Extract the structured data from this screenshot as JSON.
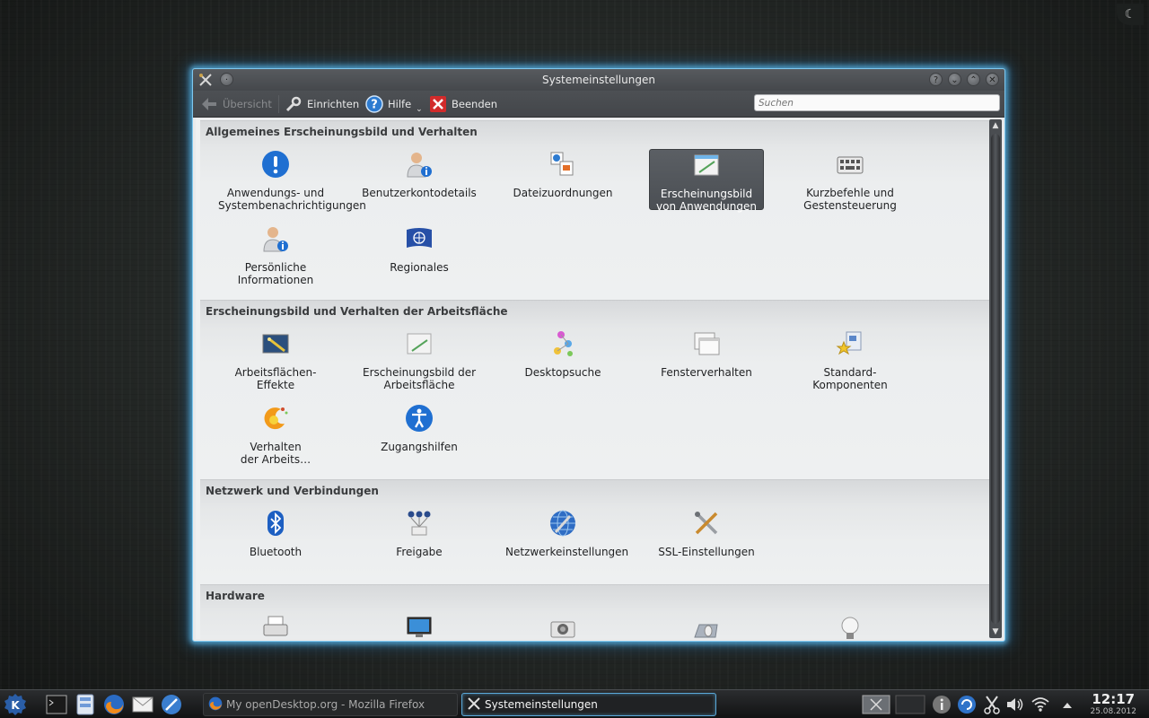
{
  "window": {
    "title": "Systemeinstellungen"
  },
  "toolbar": {
    "overview": "Übersicht",
    "configure": "Einrichten",
    "help": "Hilfe",
    "quit": "Beenden",
    "search_placeholder": "Suchen"
  },
  "sections": [
    {
      "title": "Allgemeines Erscheinungsbild und Verhalten",
      "items": [
        {
          "label": "Anwendungs- und Systembenachrichtigungen",
          "icon": "notification-icon"
        },
        {
          "label": "Benutzerkontodetails",
          "icon": "user-account-icon"
        },
        {
          "label": "Dateizuordnungen",
          "icon": "file-associations-icon"
        },
        {
          "label": "Erscheinungsbild von Anwendungen",
          "icon": "app-appearance-icon",
          "selected": true
        },
        {
          "label": "Kurzbefehle und Gestensteuerung",
          "icon": "keyboard-icon"
        },
        {
          "label": "Persönliche Informationen",
          "icon": "personal-info-icon"
        },
        {
          "label": "Regionales",
          "icon": "flag-icon"
        }
      ]
    },
    {
      "title": "Erscheinungsbild und Verhalten der Arbeitsfläche",
      "items": [
        {
          "label": "Arbeitsflächen-Effekte",
          "icon": "desktop-effects-icon"
        },
        {
          "label": "Erscheinungsbild der Arbeitsfläche",
          "icon": "workspace-appearance-icon"
        },
        {
          "label": "Desktopsuche",
          "icon": "desktop-search-icon"
        },
        {
          "label": "Fensterverhalten",
          "icon": "window-behavior-icon"
        },
        {
          "label": "Standard-Komponenten",
          "icon": "default-components-icon"
        },
        {
          "label": "Verhalten der Arbeits…",
          "icon": "workspace-behavior-icon"
        },
        {
          "label": "Zugangshilfen",
          "icon": "accessibility-icon"
        }
      ]
    },
    {
      "title": "Netzwerk und Verbindungen",
      "items": [
        {
          "label": "Bluetooth",
          "icon": "bluetooth-icon"
        },
        {
          "label": "Freigabe",
          "icon": "sharing-icon"
        },
        {
          "label": "Netzwerkeinstellungen",
          "icon": "network-icon"
        },
        {
          "label": "SSL-Einstellungen",
          "icon": "ssl-tools-icon"
        }
      ]
    },
    {
      "title": "Hardware",
      "items": [
        {
          "label": "",
          "icon": "printer-icon"
        },
        {
          "label": "",
          "icon": "display-icon"
        },
        {
          "label": "",
          "icon": "camera-icon"
        },
        {
          "label": "",
          "icon": "input-devices-icon"
        },
        {
          "label": "",
          "icon": "power-bulb-icon"
        }
      ]
    }
  ],
  "taskbar": {
    "tasks": [
      {
        "label": "My openDesktop.org - Mozilla Firefox",
        "active": false
      },
      {
        "label": "Systemeinstellungen",
        "active": true
      }
    ],
    "clock_time": "12:17",
    "clock_date": "25.08.2012"
  },
  "colors": {
    "glow": "#7fc8ee",
    "selected_bg": "#52565b",
    "toolbar_bg": "#484b4f"
  }
}
